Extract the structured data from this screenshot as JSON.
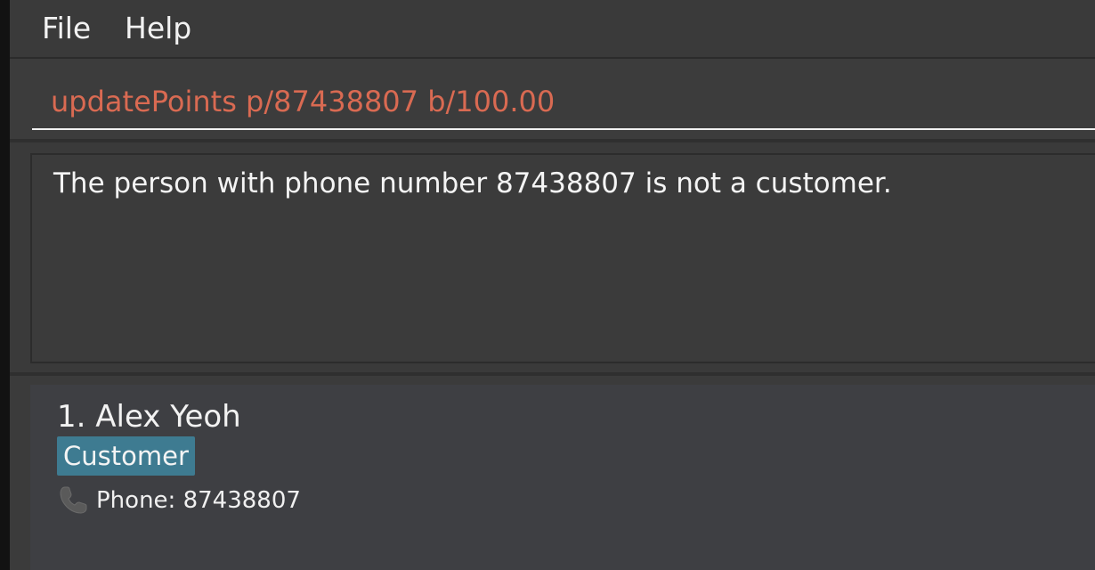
{
  "menubar": {
    "file_label": "File",
    "help_label": "Help"
  },
  "command": {
    "value": "updatePoints p/87438807 b/100.00",
    "text_color": "#d96a52"
  },
  "result": {
    "message": "The person with phone number 87438807 is not a customer."
  },
  "person_list": {
    "items": [
      {
        "name": "1. Alex Yeoh",
        "tag": "Customer",
        "phone": "Phone: 87438807",
        "icon": "phone-icon"
      }
    ]
  },
  "colors": {
    "background": "#3b3b3b",
    "tag_background": "#3e7b91",
    "error_text": "#d96a52"
  }
}
